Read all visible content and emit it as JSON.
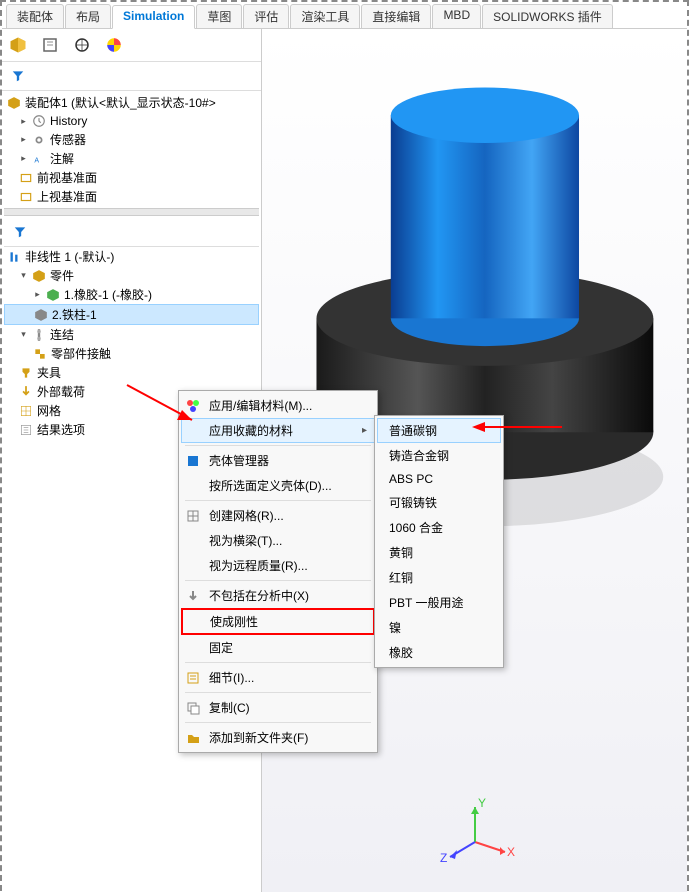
{
  "tabs": [
    "装配体",
    "布局",
    "Simulation",
    "草图",
    "评估",
    "渲染工具",
    "直接编辑",
    "MBD",
    "SOLIDWORKS 插件"
  ],
  "active_tab": "Simulation",
  "tree_root": "装配体1 (默认<默认_显示状态-10#>",
  "tree1": {
    "history": "History",
    "sensors": "传感器",
    "annotations": "注解",
    "front_plane": "前视基准面",
    "top_plane": "上视基准面"
  },
  "study_root": "非线性 1 (-默认-)",
  "parts_label": "零件",
  "part1": "1.橡胶-1 (-橡胶-)",
  "part2": "2.铁柱-1",
  "connections": "连结",
  "component_contact": "零部件接触",
  "fixtures": "夹具",
  "loads": "外部载荷",
  "mesh": "网格",
  "results": "结果选项",
  "menu": {
    "apply_edit_material": "应用/编辑材料(M)...",
    "apply_favorite": "应用收藏的材料",
    "shell_manager": "壳体管理器",
    "define_shell": "按所选面定义壳体(D)...",
    "create_mesh": "创建网格(R)...",
    "treat_beam": "视为横梁(T)...",
    "treat_remote_mass": "视为远程质量(R)...",
    "exclude": "不包括在分析中(X)",
    "make_rigid": "使成刚性",
    "fixed": "固定",
    "details": "细节(I)...",
    "copy": "复制(C)",
    "add_to_folder": "添加到新文件夹(F)"
  },
  "materials": {
    "plain_carbon": "普通碳钢",
    "cast_alloy": "铸造合金钢",
    "abs_pc": "ABS PC",
    "ductile_iron": "可锻铸铁",
    "alloy_1060": "1060 合金",
    "brass": "黄铜",
    "copper": "红铜",
    "pbt": "PBT 一般用途",
    "nickel": "镍",
    "rubber": "橡胶"
  },
  "axis": {
    "x": "X",
    "y": "Y",
    "z": "Z"
  }
}
